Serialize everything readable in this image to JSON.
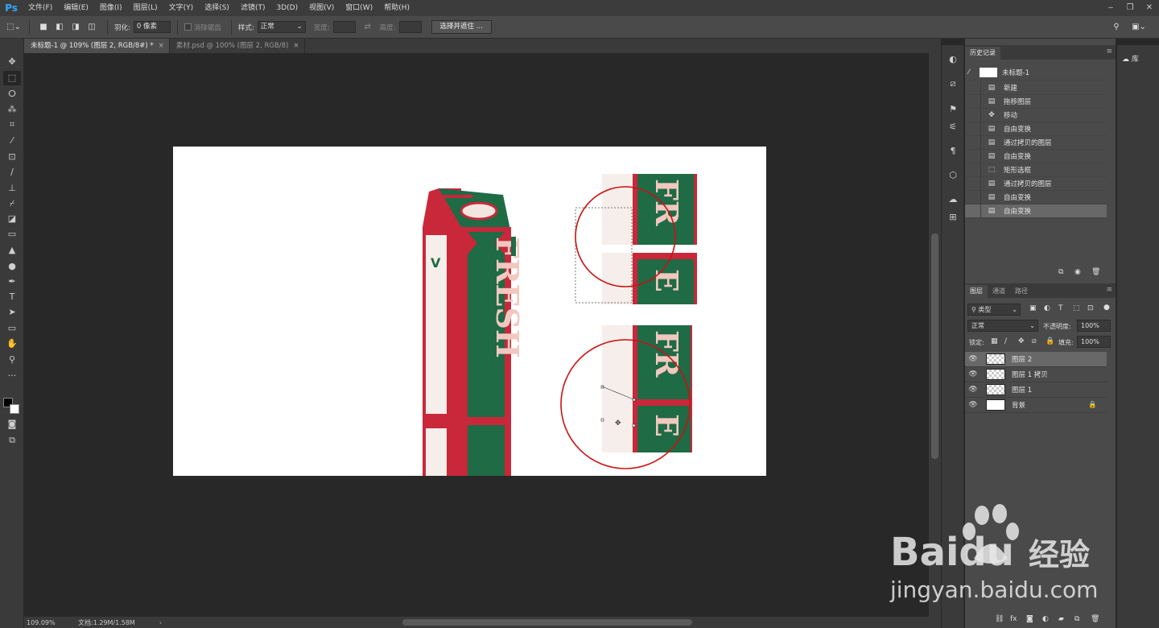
{
  "app": {
    "logo": "Ps"
  },
  "menu": [
    "文件(F)",
    "编辑(E)",
    "图像(I)",
    "图层(L)",
    "文字(Y)",
    "选择(S)",
    "滤镜(T)",
    "3D(D)",
    "视图(V)",
    "窗口(W)",
    "帮助(H)"
  ],
  "window_controls": {
    "minimize": "‒",
    "restore": "❐",
    "close": "✕"
  },
  "options": {
    "feather_label": "羽化:",
    "feather_value": "0 像素",
    "antialias_label": "消除锯齿",
    "style_label": "样式:",
    "style_value": "正常",
    "width_label": "宽度:",
    "height_label": "高度:",
    "select_mask_button": "选择并遮住 ..."
  },
  "tabs": [
    {
      "label": "未标题-1 @ 109% (图层 2, RGB/8#) *",
      "active": true
    },
    {
      "label": "素材.psd @ 100% (图层 2, RGB/8)",
      "active": false
    }
  ],
  "status": {
    "zoom": "109.09%",
    "doc": "文档:1.29M/1.58M"
  },
  "history": {
    "tabs": [
      "历史记录"
    ],
    "snapshot": "未标题-1",
    "items": [
      {
        "label": "新建",
        "icon": "doc-icon"
      },
      {
        "label": "拖移图层",
        "icon": "doc-icon"
      },
      {
        "label": "移动",
        "icon": "move-icon"
      },
      {
        "label": "自由变换",
        "icon": "doc-icon"
      },
      {
        "label": "通过拷贝的图层",
        "icon": "doc-icon"
      },
      {
        "label": "自由变换",
        "icon": "doc-icon"
      },
      {
        "label": "矩形选框",
        "icon": "marquee-icon"
      },
      {
        "label": "通过拷贝的图层",
        "icon": "doc-icon"
      },
      {
        "label": "自由变换",
        "icon": "doc-icon"
      },
      {
        "label": "自由变换",
        "icon": "doc-icon",
        "selected": true
      }
    ]
  },
  "layers": {
    "tabs": [
      "图层",
      "通道",
      "路径"
    ],
    "filter_value": "类型",
    "blend_value": "正常",
    "opacity_label": "不透明度:",
    "opacity_value": "100%",
    "lock_label": "锁定:",
    "fill_label": "填充:",
    "fill_value": "100%",
    "items": [
      {
        "name": "图层 2",
        "selected": true
      },
      {
        "name": "图层 1 拷贝",
        "selected": false
      },
      {
        "name": "图层 1",
        "selected": false
      },
      {
        "name": "背景",
        "selected": false,
        "locked": true
      }
    ]
  },
  "library": {
    "label": "库"
  },
  "watermark": {
    "brand": "Baidu",
    "brand_cn": "经验",
    "url": "jingyan.baidu.com"
  },
  "artwork": {
    "product_text": "FRESH",
    "accent": "#c8283a",
    "green": "#1e6b45",
    "selection_circle": "#cc1111"
  }
}
